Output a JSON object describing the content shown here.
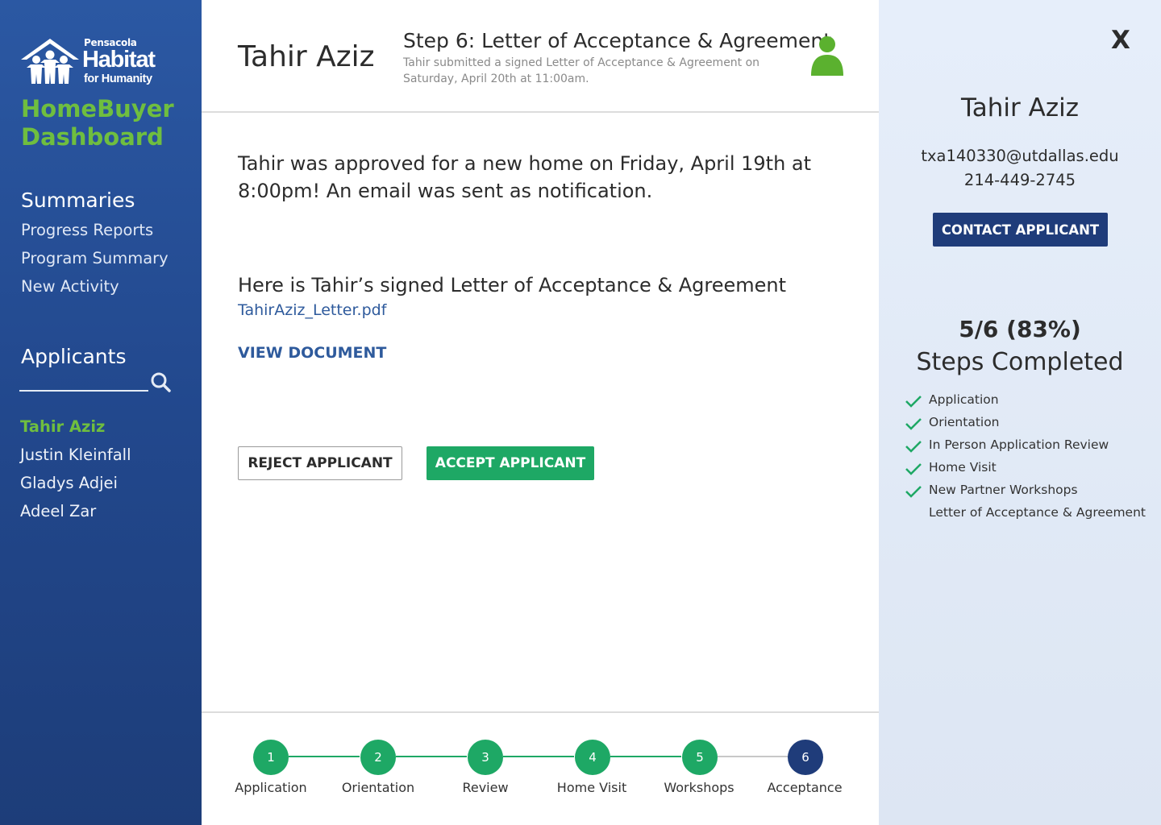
{
  "brand": {
    "logo_small": "Pensacola",
    "logo_big": "Habitat",
    "logo_for": "for Humanity",
    "title": "HomeBuyer Dashboard"
  },
  "sidebar": {
    "summaries_heading": "Summaries",
    "summaries": [
      "Progress Reports",
      "Program Summary",
      "New Activity"
    ],
    "applicants_heading": "Applicants",
    "applicants": [
      "Tahir Aziz",
      "Justin Kleinfall",
      "Gladys Adjei",
      "Adeel Zar"
    ],
    "active_applicant": "Tahir Aziz"
  },
  "header": {
    "applicant_name": "Tahir Aziz",
    "step_title": "Step 6: Letter of Acceptance & Agreement",
    "step_sub": "Tahir submitted a signed Letter of Acceptance & Agreement on Saturday, April 20th at 11:00am."
  },
  "main": {
    "approved_text": "Tahir was approved for a new home on Friday, April 19th at 8:00pm! An email was sent as notification.",
    "signed_text": "Here is Tahir’s signed Letter of Acceptance & Agreement",
    "pdf_link": "TahirAziz_Letter.pdf",
    "view_document": "VIEW DOCUMENT",
    "reject_label": "REJECT APPLICANT",
    "accept_label": "ACCEPT APPLICANT"
  },
  "progress": {
    "steps": [
      {
        "num": "1",
        "label": "Application",
        "done": true
      },
      {
        "num": "2",
        "label": "Orientation",
        "done": true
      },
      {
        "num": "3",
        "label": "Review",
        "done": true
      },
      {
        "num": "4",
        "label": "Home Visit",
        "done": true
      },
      {
        "num": "5",
        "label": "Workshops",
        "done": true
      },
      {
        "num": "6",
        "label": "Acceptance",
        "done": false
      }
    ]
  },
  "right_panel": {
    "close_label": "X",
    "name": "Tahir Aziz",
    "email": "txa140330@utdallas.edu",
    "phone": "214-449-2745",
    "contact_label": "CONTACT APPLICANT",
    "fraction": "5/6 (83%)",
    "steps_label": "Steps Completed",
    "checklist": [
      {
        "label": "Application",
        "done": true
      },
      {
        "label": "Orientation",
        "done": true
      },
      {
        "label": "In Person Application Review",
        "done": true
      },
      {
        "label": "Home Visit",
        "done": true
      },
      {
        "label": "New Partner Workshops",
        "done": true
      },
      {
        "label": "Letter of Acceptance & Agreement",
        "done": false
      }
    ]
  },
  "colors": {
    "sidebar_top": "#2b58a3",
    "sidebar_bottom": "#1d3d79",
    "accent_green": "#6fbe3f",
    "step_done": "#1ea865",
    "step_current": "#1f3c7a",
    "link_blue": "#2e5a9c"
  }
}
